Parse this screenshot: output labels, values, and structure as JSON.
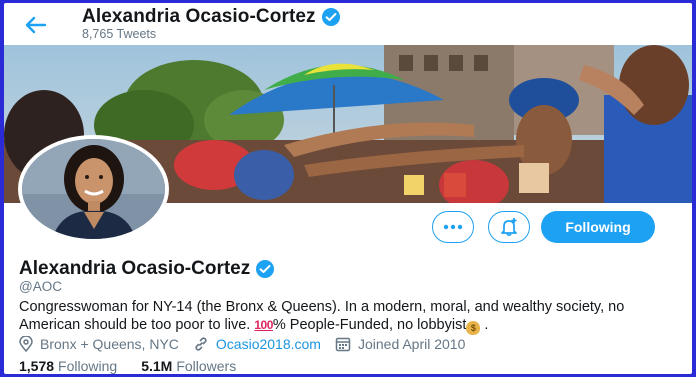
{
  "header": {
    "name": "Alexandria Ocasio-Cortez",
    "tweets_count": "8,765 Tweets"
  },
  "profile": {
    "name": "Alexandria Ocasio-Cortez",
    "handle": "@AOC",
    "bio_part1": "Congresswoman for NY-14 (the Bronx & Queens). In a modern, moral, and wealthy society, no American should be too poor to live. ",
    "bio_emoji_100": "100",
    "bio_part2": "% People-Funded, no lobbyist",
    "bio_end": " .",
    "location": "Bronx + Queens, NYC",
    "website": "Ocasio2018.com",
    "joined": "Joined April 2010"
  },
  "stats": {
    "following_count": "1,578",
    "following_label": "Following",
    "followers_count": "5.1M",
    "followers_label": "Followers"
  },
  "buttons": {
    "follow_label": "Following"
  },
  "icons": {
    "back": "arrow-left-icon",
    "verified": "verified-badge-icon",
    "more": "more-dots-icon",
    "notifications": "bell-plus-icon",
    "location": "location-pin-icon",
    "link": "link-icon",
    "calendar": "calendar-icon"
  },
  "colors": {
    "accent": "#1da1f2",
    "secondary_text": "#657786",
    "frame_border": "#2a2ad6"
  }
}
